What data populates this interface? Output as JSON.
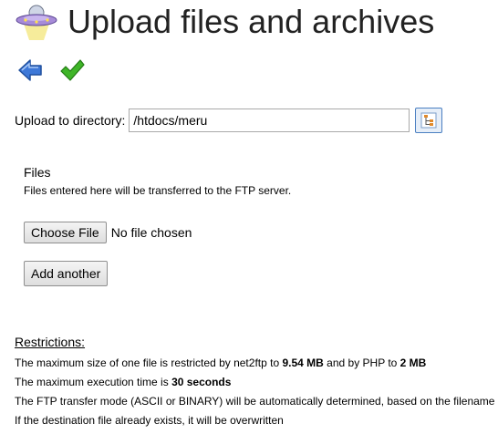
{
  "header": {
    "title": "Upload files and archives",
    "logo_icon": "ufo-icon"
  },
  "toolbar": {
    "back_icon": "back-arrow-icon",
    "submit_icon": "checkmark-icon"
  },
  "directory": {
    "label": "Upload to directory:",
    "value": "/htdocs/meru",
    "browse_icon": "tree-browse-icon"
  },
  "files": {
    "heading": "Files",
    "description": "Files entered here will be transferred to the FTP server.",
    "choose_button": "Choose File",
    "status": "No file chosen",
    "add_button": "Add another"
  },
  "restrictions": {
    "title": "Restrictions:",
    "line1_prefix": "The maximum size of one file is restricted by net2ftp to ",
    "line1_net2ftp_limit": "9.54 MB",
    "line1_mid": " and by PHP to ",
    "line1_php_limit": "2 MB",
    "line2_prefix": "The maximum execution time is ",
    "line2_time": "30 seconds",
    "line3": "The FTP transfer mode (ASCII or BINARY) will be automatically determined, based on the filename extension",
    "line4": "If the destination file already exists, it will be overwritten"
  },
  "colors": {
    "browse_border": "#4a7fc1",
    "back_arrow": "#3d78d8",
    "checkmark": "#3fb528"
  }
}
